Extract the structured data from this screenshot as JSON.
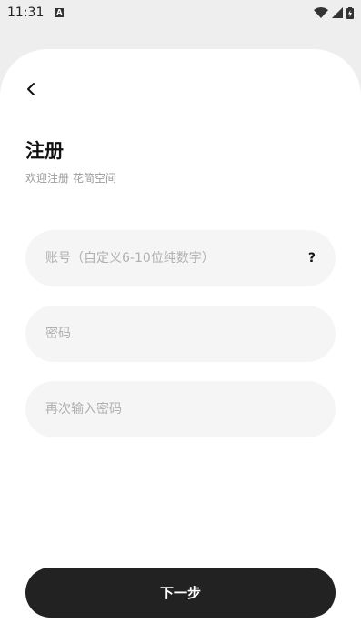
{
  "status_bar": {
    "time": "11:31",
    "notification_badge": "A",
    "icons": [
      "wifi-icon",
      "signal-icon",
      "battery-charging-icon"
    ]
  },
  "header": {
    "back_icon": "chevron-left-icon",
    "title": "注册",
    "subtitle": "欢迎注册 花简空间"
  },
  "form": {
    "account_placeholder": "账号（自定义6-10位纯数字）",
    "account_help": "?",
    "password_placeholder": "密码",
    "confirm_placeholder": "再次输入密码"
  },
  "actions": {
    "next_label": "下一步"
  },
  "colors": {
    "background": "#eeeeee",
    "sheet": "#ffffff",
    "field": "#f5f5f5",
    "primary_button": "#222222",
    "placeholder": "#b0b0b0"
  }
}
